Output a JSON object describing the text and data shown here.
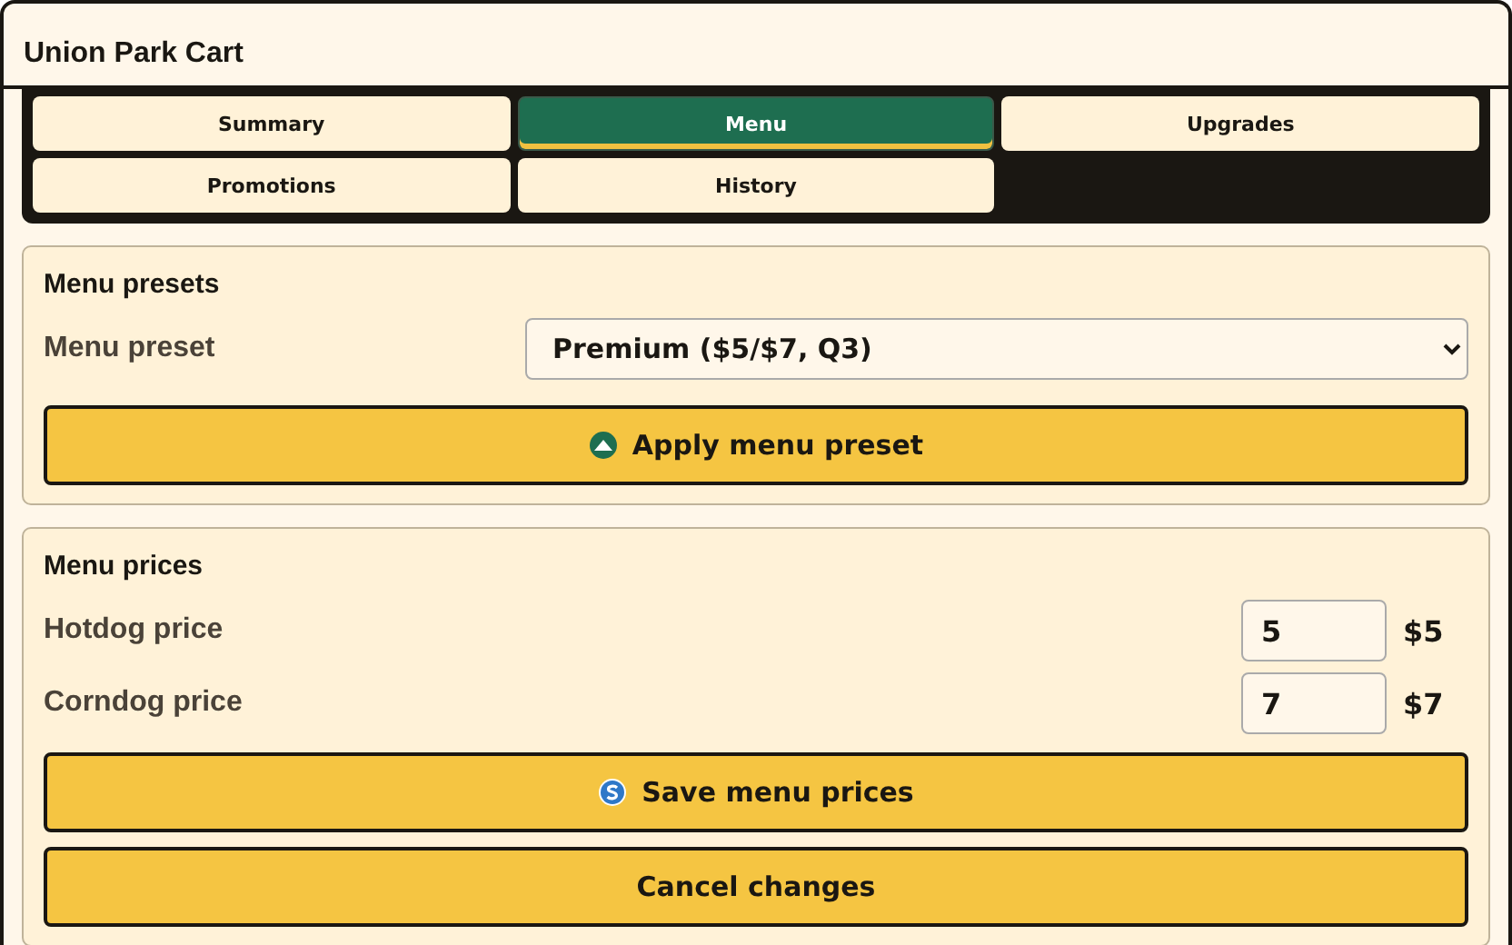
{
  "window": {
    "title": "Union Park Cart"
  },
  "tabs": [
    {
      "label": "Summary",
      "selected": false
    },
    {
      "label": "Menu",
      "selected": true
    },
    {
      "label": "Upgrades",
      "selected": false
    },
    {
      "label": "Promotions",
      "selected": false
    },
    {
      "label": "History",
      "selected": false
    }
  ],
  "presets": {
    "heading": "Menu presets",
    "label": "Menu preset",
    "value": "Premium ($5/$7, Q3)",
    "button": {
      "label": "Apply menu preset",
      "kind": "apply"
    }
  },
  "prices": {
    "heading": "Menu prices",
    "fields": [
      {
        "label": "Hotdog price",
        "value": "5",
        "display": "$5"
      },
      {
        "label": "Corndog price",
        "value": "7",
        "display": "$7"
      }
    ],
    "buttons": [
      {
        "label": "Save menu prices",
        "kind": "save"
      },
      {
        "label": "Cancel changes",
        "kind": "cancel"
      }
    ]
  }
}
